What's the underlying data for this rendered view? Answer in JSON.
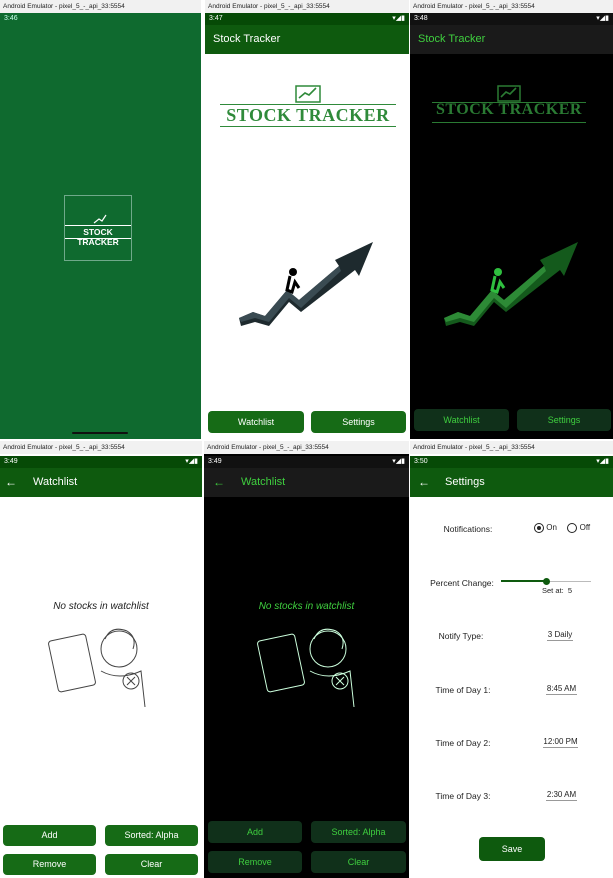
{
  "emulator": {
    "title_left": "Android Emulator - pixel_5_-_api_33:5554"
  },
  "colors": {
    "green_dark": "#0e5a0e",
    "green_splash": "#0f6a2f",
    "green_btn": "#166b16",
    "black": "#000000",
    "dark_btn": "#10301a",
    "neon_green": "#3fcf3f"
  },
  "splash": {
    "time": "3:46",
    "logo_text": "STOCK TRACKER"
  },
  "home_light": {
    "time": "3:47",
    "app_title": "Stock Tracker",
    "logo_text": "STOCK TRACKER",
    "buttons": [
      "Watchlist",
      "Settings"
    ]
  },
  "home_dark": {
    "time": "3:48",
    "app_title": "Stock Tracker",
    "logo_text": "STOCK TRACKER",
    "buttons": [
      "Watchlist",
      "Settings"
    ]
  },
  "watch_light": {
    "time": "3:49",
    "title": "Watchlist",
    "empty_text": "No stocks in watchlist",
    "buttons": {
      "add": "Add",
      "sorted": "Sorted: Alpha",
      "remove": "Remove",
      "clear": "Clear"
    }
  },
  "watch_dark": {
    "time": "3:49",
    "title": "Watchlist",
    "empty_text": "No stocks in watchlist",
    "buttons": {
      "add": "Add",
      "sorted": "Sorted: Alpha",
      "remove": "Remove",
      "clear": "Clear"
    }
  },
  "settings": {
    "time": "3:50",
    "title": "Settings",
    "notifications_label": "Notifications:",
    "on_label": "On",
    "off_label": "Off",
    "percent_label": "Percent Change:",
    "percent_value": 5,
    "set_at_label": "Set at:  5",
    "notify_type_label": "Notify Type:",
    "notify_type_value": "3 Daily",
    "tod1_label": "Time of Day 1:",
    "tod1_value": "8:45 AM",
    "tod2_label": "Time of Day 2:",
    "tod2_value": "12:00 PM",
    "tod3_label": "Time of Day 3:",
    "tod3_value": "2:30 AM",
    "save_label": "Save"
  }
}
